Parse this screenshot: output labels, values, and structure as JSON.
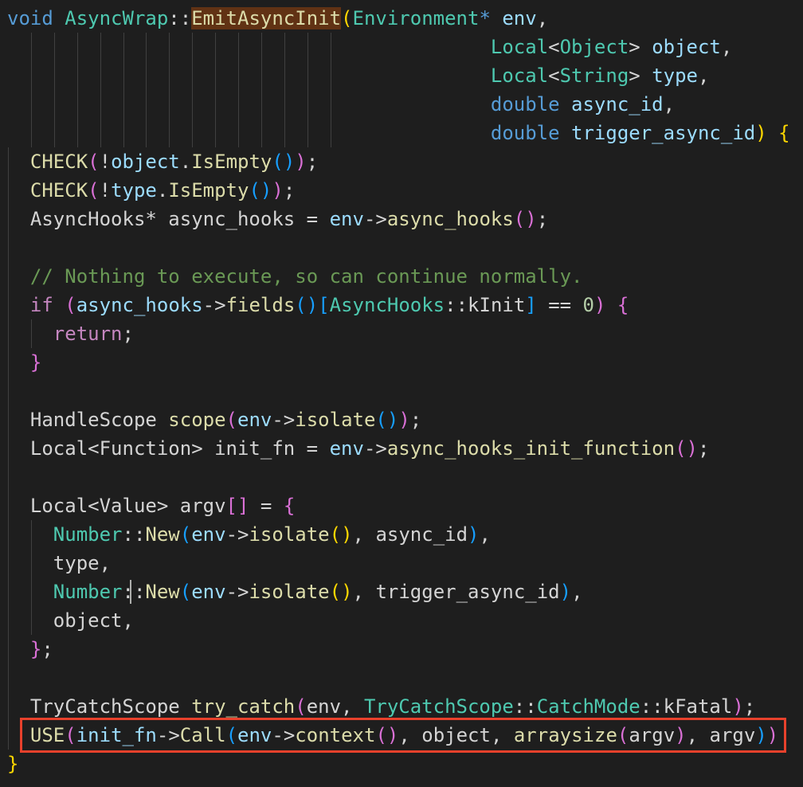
{
  "editor": {
    "language": "cpp",
    "theme": {
      "background": "#1e1e1e",
      "default": "#d4d4d4",
      "keyword": "#569cd6",
      "control": "#c586c0",
      "type": "#4ec9b0",
      "function": "#dcdcaa",
      "variable": "#9cdcfe",
      "number": "#b5cea8",
      "comment": "#6a9955",
      "bracket1": "#ffd700",
      "bracket2": "#da70d6",
      "bracket3": "#179fff",
      "word_highlight": "#613214",
      "annotation_box": "#e8412c"
    },
    "highlighted_word": "EmitAsyncInit",
    "boxed_line_index": 25,
    "cursor": {
      "line_index": 20,
      "after_text": "object,"
    },
    "lines": [
      [
        {
          "t": "void",
          "c": "keyword"
        },
        {
          "t": " "
        },
        {
          "t": "AsyncWrap",
          "c": "type"
        },
        {
          "t": "::"
        },
        {
          "t": "EmitAsyncInit",
          "c": "function",
          "hl": true
        },
        {
          "t": "(",
          "c": "bracket1"
        },
        {
          "t": "Environment",
          "c": "type"
        },
        {
          "t": "*",
          "c": "keyword"
        },
        {
          "t": " "
        },
        {
          "t": "env",
          "c": "variable"
        },
        {
          "t": ","
        }
      ],
      [
        {
          "t": "                                          "
        },
        {
          "t": "Local",
          "c": "type"
        },
        {
          "t": "<"
        },
        {
          "t": "Object",
          "c": "type"
        },
        {
          "t": ">"
        },
        {
          "t": " "
        },
        {
          "t": "object",
          "c": "variable"
        },
        {
          "t": ","
        }
      ],
      [
        {
          "t": "                                          "
        },
        {
          "t": "Local",
          "c": "type"
        },
        {
          "t": "<"
        },
        {
          "t": "String",
          "c": "type"
        },
        {
          "t": ">"
        },
        {
          "t": " "
        },
        {
          "t": "type",
          "c": "variable"
        },
        {
          "t": ","
        }
      ],
      [
        {
          "t": "                                          "
        },
        {
          "t": "double",
          "c": "keyword"
        },
        {
          "t": " "
        },
        {
          "t": "async_id",
          "c": "variable"
        },
        {
          "t": ","
        }
      ],
      [
        {
          "t": "                                          "
        },
        {
          "t": "double",
          "c": "keyword"
        },
        {
          "t": " "
        },
        {
          "t": "trigger_async_id",
          "c": "variable"
        },
        {
          "t": ")",
          "c": "bracket1"
        },
        {
          "t": " "
        },
        {
          "t": "{",
          "c": "bracket1"
        }
      ],
      [
        {
          "t": "  "
        },
        {
          "t": "CHECK",
          "c": "function"
        },
        {
          "t": "(",
          "c": "bracket2"
        },
        {
          "t": "!"
        },
        {
          "t": "object",
          "c": "variable"
        },
        {
          "t": "."
        },
        {
          "t": "IsEmpty",
          "c": "function"
        },
        {
          "t": "()",
          "c": "bracket3"
        },
        {
          "t": ")",
          "c": "bracket2"
        },
        {
          "t": ";"
        }
      ],
      [
        {
          "t": "  "
        },
        {
          "t": "CHECK",
          "c": "function"
        },
        {
          "t": "(",
          "c": "bracket2"
        },
        {
          "t": "!"
        },
        {
          "t": "type",
          "c": "variable"
        },
        {
          "t": "."
        },
        {
          "t": "IsEmpty",
          "c": "function"
        },
        {
          "t": "()",
          "c": "bracket3"
        },
        {
          "t": ")",
          "c": "bracket2"
        },
        {
          "t": ";"
        }
      ],
      [
        {
          "t": "  AsyncHooks* async_hooks = "
        },
        {
          "t": "env",
          "c": "variable"
        },
        {
          "t": "->"
        },
        {
          "t": "async_hooks",
          "c": "function"
        },
        {
          "t": "()",
          "c": "bracket2"
        },
        {
          "t": ";"
        }
      ],
      [
        {
          "t": ""
        }
      ],
      [
        {
          "t": "  "
        },
        {
          "t": "// Nothing to execute, so can continue normally.",
          "c": "comment"
        }
      ],
      [
        {
          "t": "  "
        },
        {
          "t": "if",
          "c": "control"
        },
        {
          "t": " "
        },
        {
          "t": "(",
          "c": "bracket2"
        },
        {
          "t": "async_hooks",
          "c": "variable"
        },
        {
          "t": "->"
        },
        {
          "t": "fields",
          "c": "function"
        },
        {
          "t": "()",
          "c": "bracket3"
        },
        {
          "t": "[",
          "c": "bracket3"
        },
        {
          "t": "AsyncHooks",
          "c": "type"
        },
        {
          "t": "::"
        },
        {
          "t": "kInit"
        },
        {
          "t": "]",
          "c": "bracket3"
        },
        {
          "t": " == "
        },
        {
          "t": "0",
          "c": "number"
        },
        {
          "t": ")",
          "c": "bracket2"
        },
        {
          "t": " "
        },
        {
          "t": "{",
          "c": "bracket2"
        }
      ],
      [
        {
          "t": "    "
        },
        {
          "t": "return",
          "c": "control"
        },
        {
          "t": ";"
        }
      ],
      [
        {
          "t": "  "
        },
        {
          "t": "}",
          "c": "bracket2"
        }
      ],
      [
        {
          "t": ""
        }
      ],
      [
        {
          "t": "  HandleScope "
        },
        {
          "t": "scope",
          "c": "function"
        },
        {
          "t": "(",
          "c": "bracket2"
        },
        {
          "t": "env",
          "c": "variable"
        },
        {
          "t": "->"
        },
        {
          "t": "isolate",
          "c": "function"
        },
        {
          "t": "()",
          "c": "bracket3"
        },
        {
          "t": ")",
          "c": "bracket2"
        },
        {
          "t": ";"
        }
      ],
      [
        {
          "t": "  Local<Function> init_fn = "
        },
        {
          "t": "env",
          "c": "variable"
        },
        {
          "t": "->"
        },
        {
          "t": "async_hooks_init_function",
          "c": "function"
        },
        {
          "t": "()",
          "c": "bracket2"
        },
        {
          "t": ";"
        }
      ],
      [
        {
          "t": ""
        }
      ],
      [
        {
          "t": "  Local<Value> argv"
        },
        {
          "t": "[]",
          "c": "bracket2"
        },
        {
          "t": " = "
        },
        {
          "t": "{",
          "c": "bracket2"
        }
      ],
      [
        {
          "t": "    "
        },
        {
          "t": "Number",
          "c": "type"
        },
        {
          "t": "::"
        },
        {
          "t": "New",
          "c": "function"
        },
        {
          "t": "(",
          "c": "bracket3"
        },
        {
          "t": "env",
          "c": "variable"
        },
        {
          "t": "->"
        },
        {
          "t": "isolate",
          "c": "function"
        },
        {
          "t": "()",
          "c": "bracket1"
        },
        {
          "t": ", async_id"
        },
        {
          "t": ")",
          "c": "bracket3"
        },
        {
          "t": ","
        }
      ],
      [
        {
          "t": "    type,"
        }
      ],
      [
        {
          "t": "    "
        },
        {
          "t": "Number",
          "c": "type"
        },
        {
          "t": "::"
        },
        {
          "t": "New",
          "c": "function"
        },
        {
          "t": "(",
          "c": "bracket3"
        },
        {
          "t": "env",
          "c": "variable"
        },
        {
          "t": "->"
        },
        {
          "t": "isolate",
          "c": "function"
        },
        {
          "t": "()",
          "c": "bracket1"
        },
        {
          "t": ", trigger_async_id"
        },
        {
          "t": ")",
          "c": "bracket3"
        },
        {
          "t": ","
        }
      ],
      [
        {
          "t": "    object,"
        }
      ],
      [
        {
          "t": "  "
        },
        {
          "t": "}",
          "c": "bracket2"
        },
        {
          "t": ";"
        }
      ],
      [
        {
          "t": ""
        }
      ],
      [
        {
          "t": "  TryCatchScope "
        },
        {
          "t": "try_catch",
          "c": "function"
        },
        {
          "t": "(",
          "c": "bracket2"
        },
        {
          "t": "env, "
        },
        {
          "t": "TryCatchScope",
          "c": "type"
        },
        {
          "t": "::"
        },
        {
          "t": "CatchMode",
          "c": "type"
        },
        {
          "t": "::kFatal"
        },
        {
          "t": ")",
          "c": "bracket2"
        },
        {
          "t": ";"
        }
      ],
      [
        {
          "t": "  "
        },
        {
          "t": "USE",
          "c": "function"
        },
        {
          "t": "(",
          "c": "bracket2"
        },
        {
          "t": "init_fn",
          "c": "variable"
        },
        {
          "t": "->"
        },
        {
          "t": "Call",
          "c": "function"
        },
        {
          "t": "(",
          "c": "bracket3"
        },
        {
          "t": "env",
          "c": "variable"
        },
        {
          "t": "->"
        },
        {
          "t": "context",
          "c": "function"
        },
        {
          "t": "()",
          "c": "bracket2"
        },
        {
          "t": ", object, "
        },
        {
          "t": "arraysize",
          "c": "function"
        },
        {
          "t": "(",
          "c": "bracket2"
        },
        {
          "t": "argv"
        },
        {
          "t": ")",
          "c": "bracket2"
        },
        {
          "t": ", argv"
        },
        {
          "t": ")",
          "c": "bracket3"
        },
        {
          "t": ")",
          "c": "bracket2"
        }
      ],
      [
        {
          "t": "}",
          "c": "bracket1"
        }
      ]
    ]
  }
}
